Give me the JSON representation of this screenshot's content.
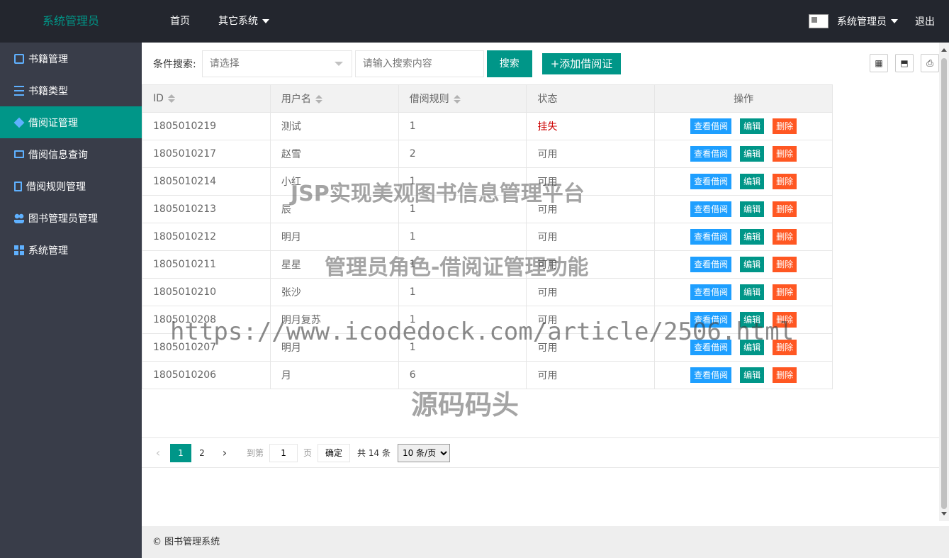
{
  "header": {
    "logo": "系统管理员",
    "nav": [
      {
        "label": "首页"
      },
      {
        "label": "其它系统"
      }
    ],
    "user_name": "系统管理员",
    "logout": "退出"
  },
  "sidebar": {
    "items": [
      {
        "label": "书籍管理",
        "icon": "book-icon"
      },
      {
        "label": "书籍类型",
        "icon": "grid-icon"
      },
      {
        "label": "借阅证管理",
        "icon": "layers-icon",
        "active": true
      },
      {
        "label": "借阅信息查询",
        "icon": "monitor-icon"
      },
      {
        "label": "借阅规则管理",
        "icon": "document-icon"
      },
      {
        "label": "图书管理员管理",
        "icon": "users-icon"
      },
      {
        "label": "系统管理",
        "icon": "windows-icon"
      }
    ]
  },
  "toolbar": {
    "search_label": "条件搜索:",
    "select_placeholder": "请选择",
    "input_placeholder": "请输入搜索内容",
    "search_button": "搜索",
    "add_button": "+添加借阅证"
  },
  "table": {
    "headers": [
      "ID",
      "用户名",
      "借阅规则",
      "状态",
      "操作"
    ],
    "rows": [
      {
        "id": "1805010219",
        "user": "测试",
        "rule": "1",
        "status": "挂失"
      },
      {
        "id": "1805010217",
        "user": "赵雪",
        "rule": "2",
        "status": "可用"
      },
      {
        "id": "1805010214",
        "user": "小红",
        "rule": "1",
        "status": "可用"
      },
      {
        "id": "1805010213",
        "user": "辰",
        "rule": "1",
        "status": "可用"
      },
      {
        "id": "1805010212",
        "user": "明月",
        "rule": "1",
        "status": "可用"
      },
      {
        "id": "1805010211",
        "user": "星星",
        "rule": "1",
        "status": "可用"
      },
      {
        "id": "1805010210",
        "user": "张沙",
        "rule": "1",
        "status": "可用"
      },
      {
        "id": "1805010208",
        "user": "明月复苏",
        "rule": "1",
        "status": "可用"
      },
      {
        "id": "1805010207",
        "user": "明月",
        "rule": "1",
        "status": "可用"
      },
      {
        "id": "1805010206",
        "user": "月",
        "rule": "6",
        "status": "可用"
      }
    ],
    "ops": {
      "view": "查看借阅",
      "edit": "编辑",
      "delete": "删除"
    }
  },
  "pager": {
    "pages": [
      "1",
      "2"
    ],
    "current": "1",
    "goto_label": "到第",
    "goto_value": "1",
    "page_unit": "页",
    "confirm": "确定",
    "total": "共 14 条",
    "per_page": "10 条/页"
  },
  "footer": {
    "text": "© 图书管理系统"
  },
  "watermark": {
    "line1": "JSP实现美观图书信息管理平台",
    "line2": "管理员角色-借阅证管理功能",
    "line3": "https://www.icodedock.com/article/2506.html",
    "line4": "源码码头"
  },
  "colors": {
    "primary": "#009688",
    "header_bg": "#23262e",
    "sidebar_bg": "#393d49",
    "view": "#1e9fff",
    "delete": "#ff5722"
  }
}
